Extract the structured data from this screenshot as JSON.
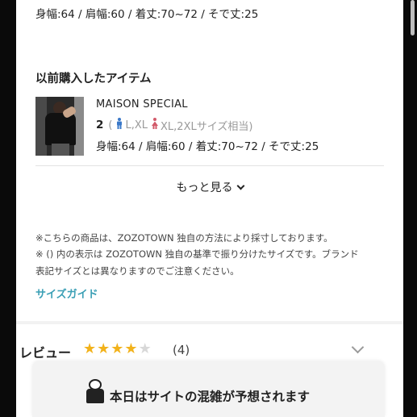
{
  "top_measurements": "身幅:64 / 肩幅:60 / 着丈:70~72 / そで丈:25",
  "previous_items": {
    "title": "以前購入したアイテム",
    "item": {
      "brand": "MAISON SPECIAL",
      "size": "2",
      "paren_open": "(",
      "male_size": "L,XL",
      "female_size": "XL,2XLサイズ相当)",
      "measurements": "身幅:64 / 肩幅:60 / 着丈:70~72 / そで丈:25"
    },
    "more_label": "もっと見る"
  },
  "notes": {
    "line1": "※こちらの商品は、ZOZOTOWN 独自の方法により採寸しております。",
    "line2": "※ () 内の表示は ZOZOTOWN 独自の基準で振り分けたサイズです。ブランド",
    "line3": "表記サイズとは異なりますのでご注意ください。",
    "size_guide": "サイズガイド"
  },
  "review": {
    "title": "レビュー",
    "rating": 4,
    "max_rating": 5,
    "count": "(4)"
  },
  "banner": {
    "text": "本日はサイトの混雑が予想されます"
  },
  "colors": {
    "accent_link": "#3a9fb5",
    "star": "#f2b21b",
    "male": "#3a78c8",
    "female": "#d25a6a"
  }
}
